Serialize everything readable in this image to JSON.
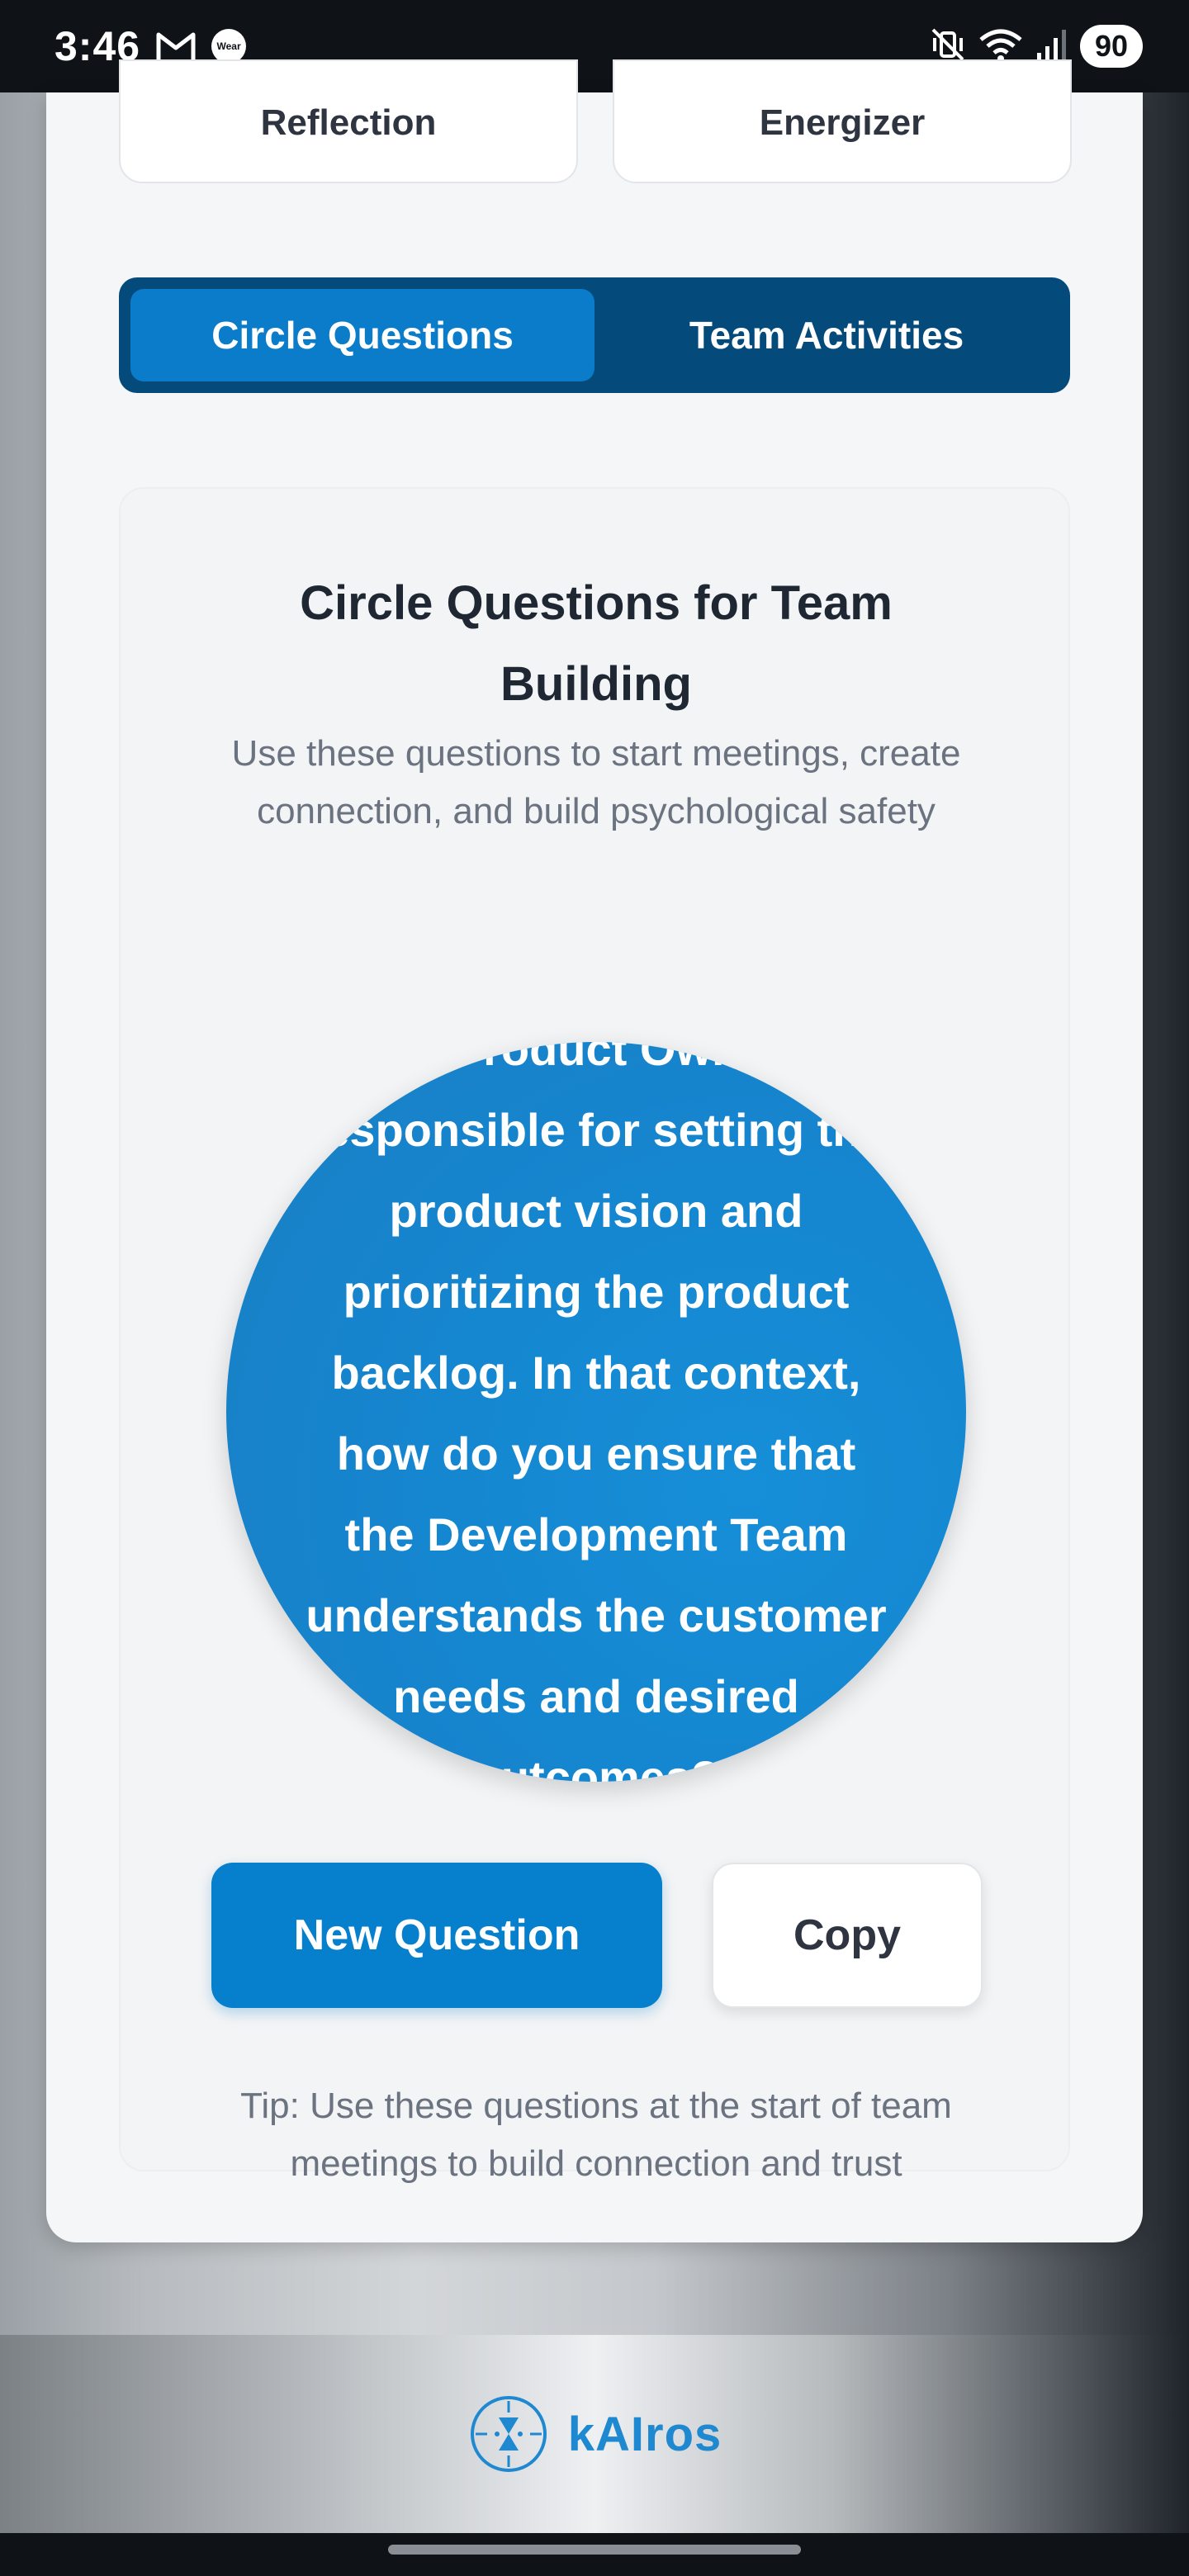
{
  "status_bar": {
    "time": "3:46",
    "wear_label": "Wear",
    "battery": "90",
    "icons": [
      "gmail-icon",
      "wear-icon",
      "vibrate-icon",
      "wifi-icon",
      "signal-icon"
    ]
  },
  "top_tiles": {
    "left_label": "Reflection",
    "right_label": "Energizer"
  },
  "tabs": [
    {
      "label": "Circle Questions",
      "active": true
    },
    {
      "label": "Team Activities",
      "active": false
    }
  ],
  "circle_section": {
    "title": "Circle Questions for Team Building",
    "subtitle": "Use these questions to start meetings, create connection, and build psychological safety",
    "question": "The Product Owner is responsible for setting the product vision and prioritizing the product backlog. In that context, how do you ensure that the Development Team understands the customer needs and desired outcomes?",
    "new_question_label": "New Question",
    "copy_label": "Copy",
    "tip": "Tip: Use these questions at the start of team meetings to build connection and trust"
  },
  "brand": {
    "name": "kAIros"
  },
  "colors": {
    "accent": "#067fcc",
    "tab_bar": "#044b7c",
    "circle": "#1586d0",
    "brand_text": "#1e88d0"
  }
}
